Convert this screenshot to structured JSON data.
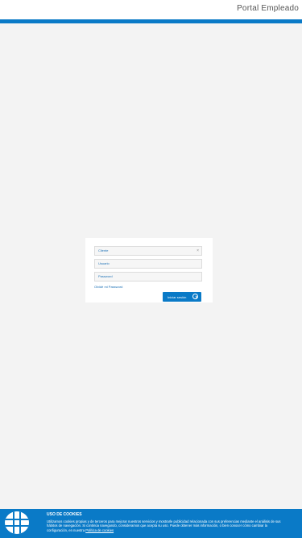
{
  "header": {
    "title": "Portal Empleado"
  },
  "login": {
    "client_placeholder": "Cliente",
    "clear_symbol": "×",
    "user_placeholder": "Usuario",
    "password_placeholder": "Password",
    "forgot_label": "Olvidé mi Password",
    "submit_label": "Iniciar sesión",
    "submit_icon": "arrow-right-circle-icon"
  },
  "cookies": {
    "title": "USO DE COOKIES",
    "text": "Utilizamos cookies propias y de terceros para mejorar nuestros servicios y mostrarle publicidad relacionada con sus preferencias mediante el análisis de sus hábitos de navegación. Si continúa navegando, consideramos que acepta su uso. Puede obtener más información, o bien conocer cómo cambiar la configuración, en nuestra",
    "link_label": "Política de cookies",
    "logo_icon": "grid-logo-icon"
  },
  "colors": {
    "accent": "#0a7ac7",
    "background": "#f3f3f3"
  }
}
